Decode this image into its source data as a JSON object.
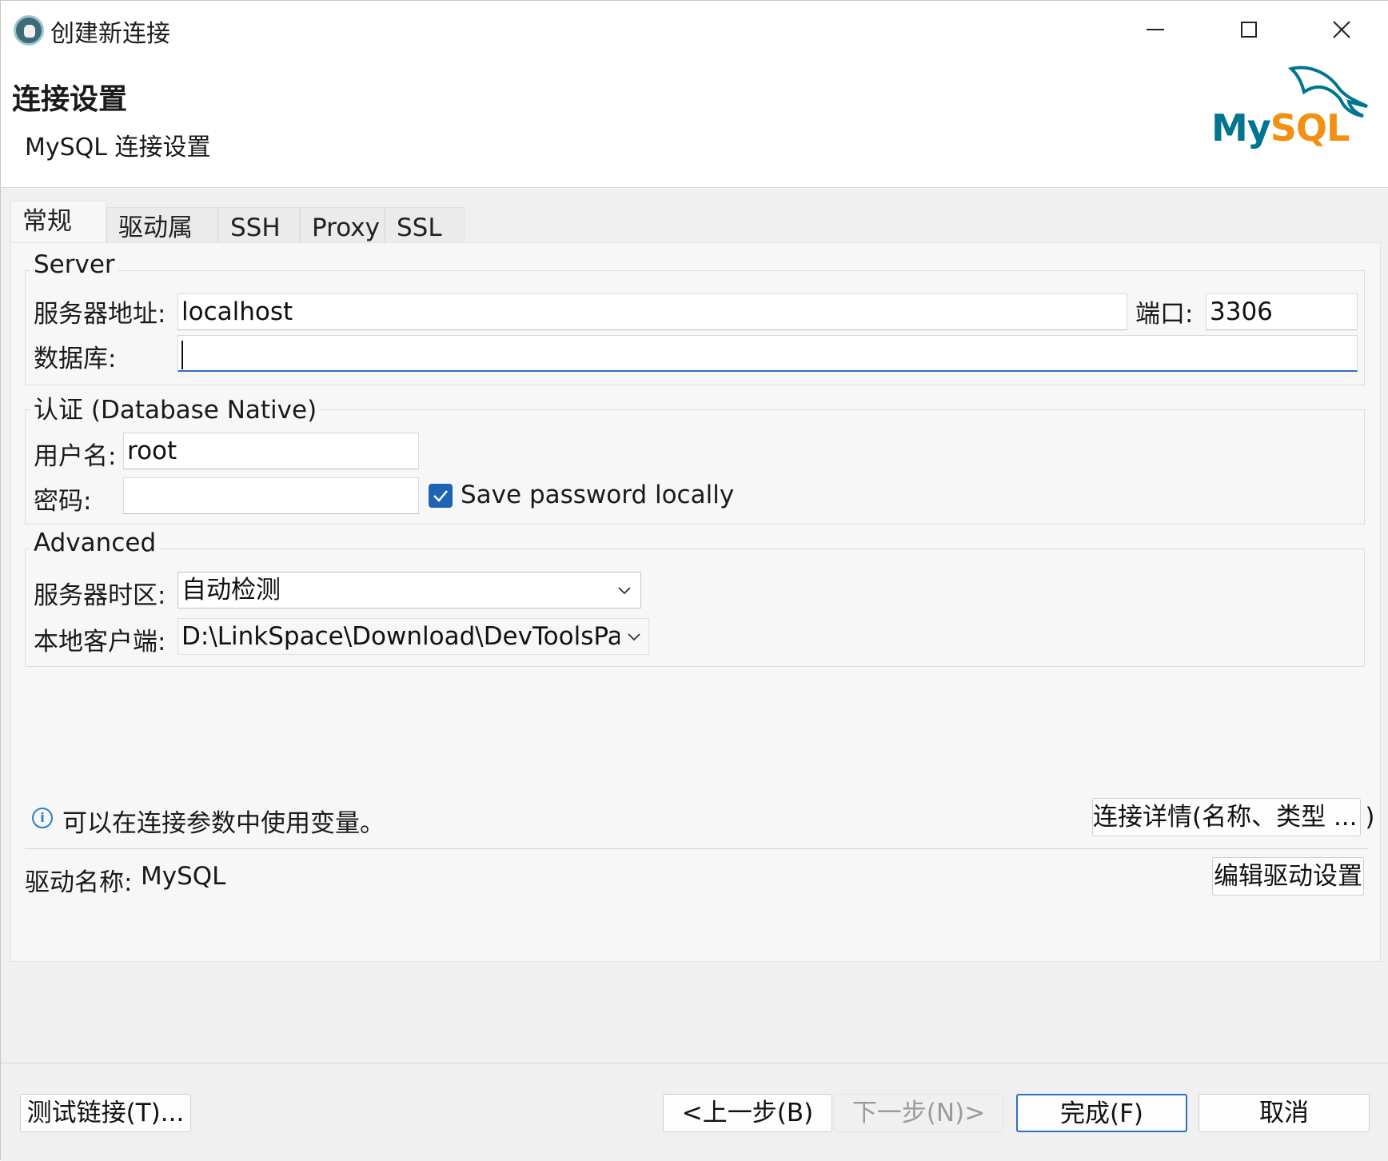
{
  "window": {
    "title": "创建新连接",
    "icon": "dbeaver-icon"
  },
  "header": {
    "title": "连接设置",
    "subtitle": "MySQL 连接设置",
    "logo_text_my": "My",
    "logo_text_sql": "SQL"
  },
  "tabs": [
    {
      "label": "常规",
      "active": true
    },
    {
      "label": "驱动属性",
      "active": false
    },
    {
      "label": "SSH",
      "active": false
    },
    {
      "label": "Proxy",
      "active": false
    },
    {
      "label": "SSL",
      "active": false
    }
  ],
  "server": {
    "group_title": "Server",
    "host_label": "服务器地址:",
    "host_value": "localhost",
    "port_label": "端口:",
    "port_value": "3306",
    "database_label": "数据库:",
    "database_value": ""
  },
  "auth": {
    "group_title": "认证 (Database Native)",
    "username_label": "用户名:",
    "username_value": "root",
    "password_label": "密码:",
    "password_value": "",
    "save_password_label": "Save password locally",
    "save_password_checked": true
  },
  "advanced": {
    "group_title": "Advanced",
    "timezone_label": "服务器时区:",
    "timezone_value": "自动检测",
    "client_label": "本地客户端:",
    "client_value": "D:\\LinkSpace\\Download\\DevToolsPacl"
  },
  "info": {
    "text": "可以在连接参数中使用变量。",
    "details_button": "连接详情(名称、类型 ... )"
  },
  "driver": {
    "label": "驱动名称:",
    "value": "MySQL",
    "edit_button": "编辑驱动设置"
  },
  "footer": {
    "test_button": "测试链接(T)...",
    "back_button": "<上一步(B)",
    "next_button": "下一步(N)>",
    "finish_button": "完成(F)",
    "cancel_button": "取消"
  },
  "colors": {
    "accent": "#2f6fbf",
    "mysql_blue": "#00758f",
    "mysql_orange": "#f29111"
  }
}
